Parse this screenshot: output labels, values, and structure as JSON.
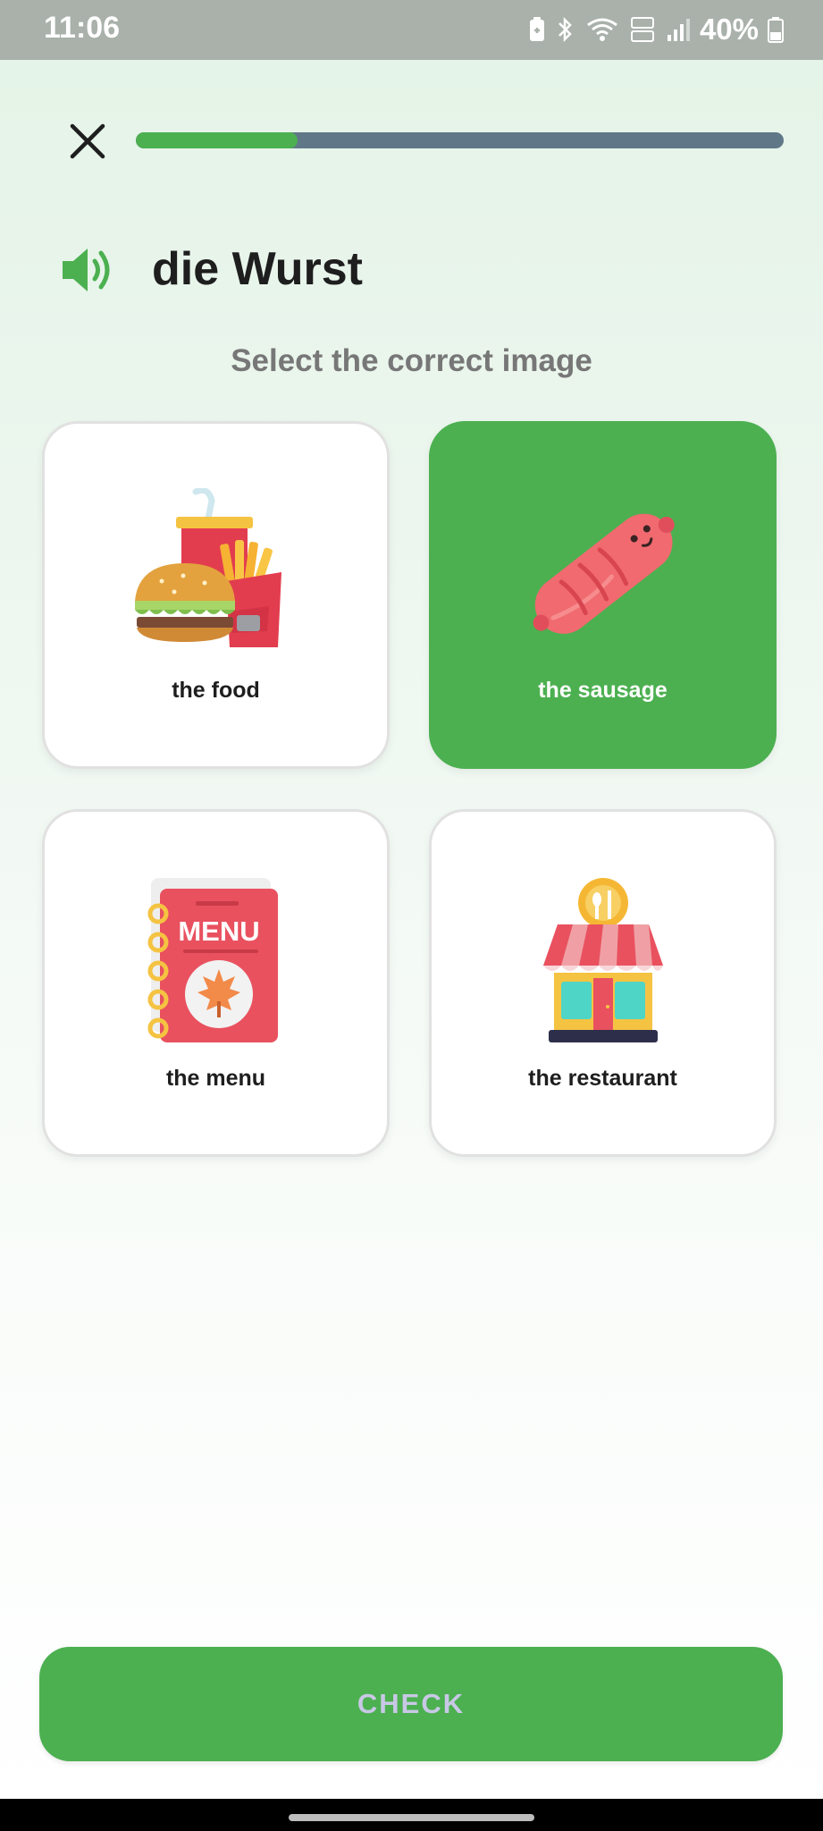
{
  "status_bar": {
    "time": "11:06",
    "battery_text": "40%",
    "icons": [
      "battery-saver-icon",
      "bluetooth-icon",
      "wifi-icon",
      "volte-icon",
      "signal-icon",
      "battery-icon"
    ]
  },
  "lesson": {
    "progress": 0.25,
    "word": "die Wurst",
    "instruction": "Select the correct image"
  },
  "options": [
    {
      "label": "the food",
      "icon": "burger-fries-soda-icon",
      "selected": false
    },
    {
      "label": "the sausage",
      "icon": "sausage-icon",
      "selected": true
    },
    {
      "label": "the menu",
      "icon": "menu-book-icon",
      "selected": false,
      "icon_text": "MENU"
    },
    {
      "label": "the restaurant",
      "icon": "restaurant-icon",
      "selected": false
    }
  ],
  "check_button": {
    "label": "CHECK"
  },
  "colors": {
    "accent": "#4cb050",
    "progress_track": "#607788",
    "instruction_text": "#777777",
    "check_label": "#c8c8e6"
  }
}
